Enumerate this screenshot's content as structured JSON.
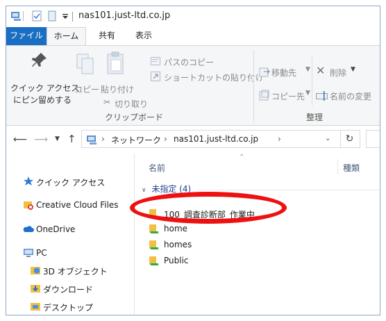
{
  "window": {
    "title": "nas101.just-ltd.co.jp"
  },
  "tabs": [
    {
      "label": "ファイル"
    },
    {
      "label": "ホーム"
    },
    {
      "label": "共有"
    },
    {
      "label": "表示"
    }
  ],
  "ribbon": {
    "pin_line1": "クイック アクセス",
    "pin_line2": "にピン留めする",
    "copy": "コピー",
    "paste": "貼り付け",
    "copy_path": "パスのコピー",
    "paste_shortcut": "ショートカットの貼り付け",
    "cut": "切り取り",
    "clipboard_group": "クリップボード",
    "move_to": "移動先",
    "copy_to": "コピー先",
    "delete": "削除",
    "rename": "名前の変更",
    "organize_group": "整理"
  },
  "address": {
    "crumbs": [
      "ネットワーク",
      "nas101.just-ltd.co.jp"
    ]
  },
  "nav": {
    "items": [
      {
        "label": "クイック アクセス",
        "icon": "star-icon"
      },
      {
        "label": "Creative Cloud Files",
        "icon": "creative-cloud-icon"
      },
      {
        "label": "OneDrive",
        "icon": "cloud-icon"
      },
      {
        "label": "PC",
        "icon": "pc-icon"
      },
      {
        "label": "3D オブジェクト",
        "icon": "3d-objects-icon"
      },
      {
        "label": "ダウンロード",
        "icon": "download-folder-icon"
      },
      {
        "label": "デスクトップ",
        "icon": "desktop-folder-icon"
      }
    ]
  },
  "list": {
    "headers": {
      "name": "名前",
      "type": "種類"
    },
    "group": "未指定 (4)",
    "items": [
      {
        "label": "100_調査診断部_作業中"
      },
      {
        "label": "home"
      },
      {
        "label": "homes"
      },
      {
        "label": "Public"
      }
    ]
  },
  "colors": {
    "accent": "#1a6ec3",
    "highlight": "#ee1111",
    "folder": "#f0c040"
  }
}
